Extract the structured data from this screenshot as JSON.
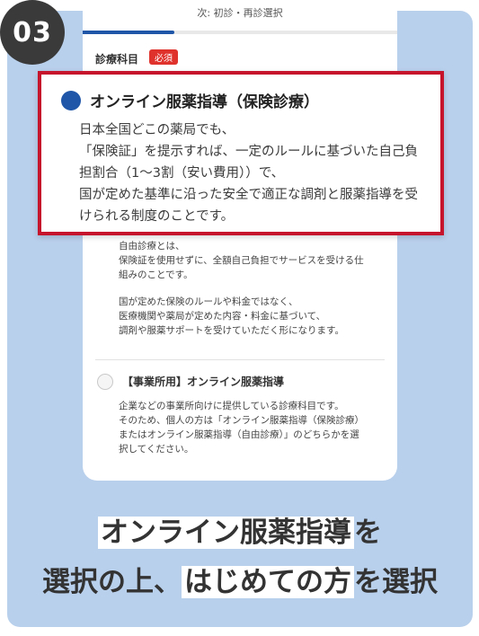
{
  "step_number": "03",
  "header": {
    "next_label": "次: 初診・再診選択",
    "progress": 0.29
  },
  "section": {
    "label": "診療科目",
    "required_badge": "必須"
  },
  "highlight_option": {
    "title": "オンライン服薬指導（保険診療）",
    "body_lines": [
      "日本全国どこの薬局でも、",
      "「保険証」を提示すれば、一定のルールに基づいた自己負",
      "担割合（1〜3割（安い費用））で、",
      "国が定めた基準に沿った安全で適正な調剤と服薬指導を受",
      "けられる制度のことです。"
    ]
  },
  "option_free": {
    "desc_lines_1": [
      "自由診療とは、",
      "保険証を使用せずに、全額自己負担でサービスを受ける仕",
      "組みのことです。"
    ],
    "desc_lines_2": [
      "国が定めた保険のルールや料金ではなく、",
      "医療機関や薬局が定めた内容・料金に基づいて、",
      "調剤や服薬サポートを受けていただく形になります。"
    ]
  },
  "option_business": {
    "title": "【事業所用】オンライン服薬指導",
    "desc_lines": [
      "企業などの事業所向けに提供している診療科目です。",
      "そのため、個人の方は「オンライン服薬指導（保険診療）",
      "またはオンライン服薬指導（自由診療）」のどちらかを選",
      "択してください。"
    ]
  },
  "caption": {
    "line1_marked": "オンライン服薬指導",
    "line1_rest": "を",
    "line2_pre": "選択の上、",
    "line2_marked": "はじめての方",
    "line2_rest": "を選択"
  },
  "colors": {
    "accent": "#1f56a8",
    "highlight_border": "#c5142c",
    "required": "#e0322d",
    "background": "#b9d0ec"
  }
}
